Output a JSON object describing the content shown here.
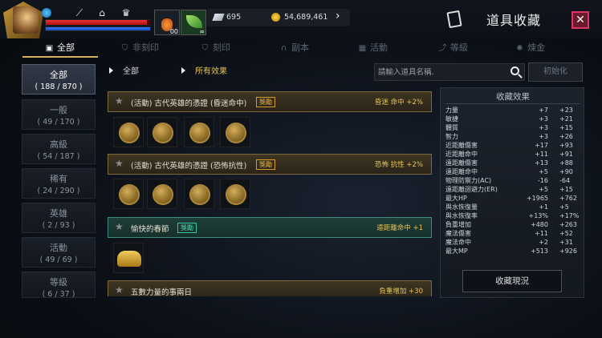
{
  "header": {
    "title": "道具收藏",
    "diamonds": "695",
    "gold": "54,689,461",
    "slot2_badge": "∞",
    "slot1_badge": "00"
  },
  "player": {
    "hp_fraction": 0.97,
    "mp_fraction": 1.0
  },
  "tabs": [
    {
      "label": "全部",
      "active": true
    },
    {
      "label": "非刻印",
      "active": false
    },
    {
      "label": "刻印",
      "active": false
    },
    {
      "label": "副本",
      "active": false
    },
    {
      "label": "活動",
      "active": false
    },
    {
      "label": "等級",
      "active": false
    },
    {
      "label": "煉金",
      "active": false
    }
  ],
  "categories": [
    {
      "name": "全部",
      "count": "( 188 / 870 )",
      "active": true
    },
    {
      "name": "一般",
      "count": "( 49 / 170 )",
      "active": false
    },
    {
      "name": "高級",
      "count": "( 54 / 187 )",
      "active": false
    },
    {
      "name": "稀有",
      "count": "( 24 / 290 )",
      "active": false
    },
    {
      "name": "英雄",
      "count": "( 2 / 93 )",
      "active": false
    },
    {
      "name": "活動",
      "count": "( 49 / 69 )",
      "active": false
    },
    {
      "name": "等級",
      "count": "( 6 / 37 )",
      "active": false
    }
  ],
  "filter": {
    "type_value": "全部",
    "effect_value": "所有效果"
  },
  "search": {
    "placeholder": "請輸入道具名稱."
  },
  "reset_label": "初始化",
  "collections": [
    {
      "name": "(活動) 古代英雄的憑證 (昏迷命中)",
      "badge": "獎勵",
      "effect": "昏迷 命中 +2%",
      "style": "gold"
    },
    {
      "name": "(活動) 古代英雄的憑證 (恐怖抗性)",
      "badge": "獎勵",
      "effect": "恐怖 抗性 +2%",
      "style": "gold"
    },
    {
      "name": "愉快的春節",
      "badge": "獎勵",
      "effect": "遠距離命中 +1",
      "style": "green"
    },
    {
      "name": "五數力量的事兩日",
      "badge": "",
      "effect": "負重增加 +30",
      "style": "gold"
    }
  ],
  "effects_panel": {
    "title": "收藏效果",
    "rows": [
      {
        "stat": "力量",
        "current": "+7",
        "max": "+23"
      },
      {
        "stat": "敏捷",
        "current": "+3",
        "max": "+21"
      },
      {
        "stat": "體質",
        "current": "+3",
        "max": "+15"
      },
      {
        "stat": "智力",
        "current": "+3",
        "max": "+26"
      },
      {
        "stat": "近距離傷害",
        "current": "+17",
        "max": "+93"
      },
      {
        "stat": "近距離命中",
        "current": "+11",
        "max": "+91"
      },
      {
        "stat": "遠距離傷害",
        "current": "+13",
        "max": "+88"
      },
      {
        "stat": "遠距離命中",
        "current": "+5",
        "max": "+90"
      },
      {
        "stat": "物理防禦力(AC)",
        "current": "-16",
        "max": "-64"
      },
      {
        "stat": "遠距離迴避力(ER)",
        "current": "+5",
        "max": "+15"
      },
      {
        "stat": "最大HP",
        "current": "+1965",
        "max": "+762"
      },
      {
        "stat": "與水恢復量",
        "current": "+1",
        "max": "+5"
      },
      {
        "stat": "與水恢復率",
        "current": "+13%",
        "max": "+17%"
      },
      {
        "stat": "負重增加",
        "current": "+480",
        "max": "+263"
      },
      {
        "stat": "魔法傷害",
        "current": "+11",
        "max": "+52"
      },
      {
        "stat": "魔法命中",
        "current": "+2",
        "max": "+31"
      },
      {
        "stat": "最大MP",
        "current": "+513",
        "max": "+926"
      }
    ]
  },
  "status_button": "收藏現況"
}
